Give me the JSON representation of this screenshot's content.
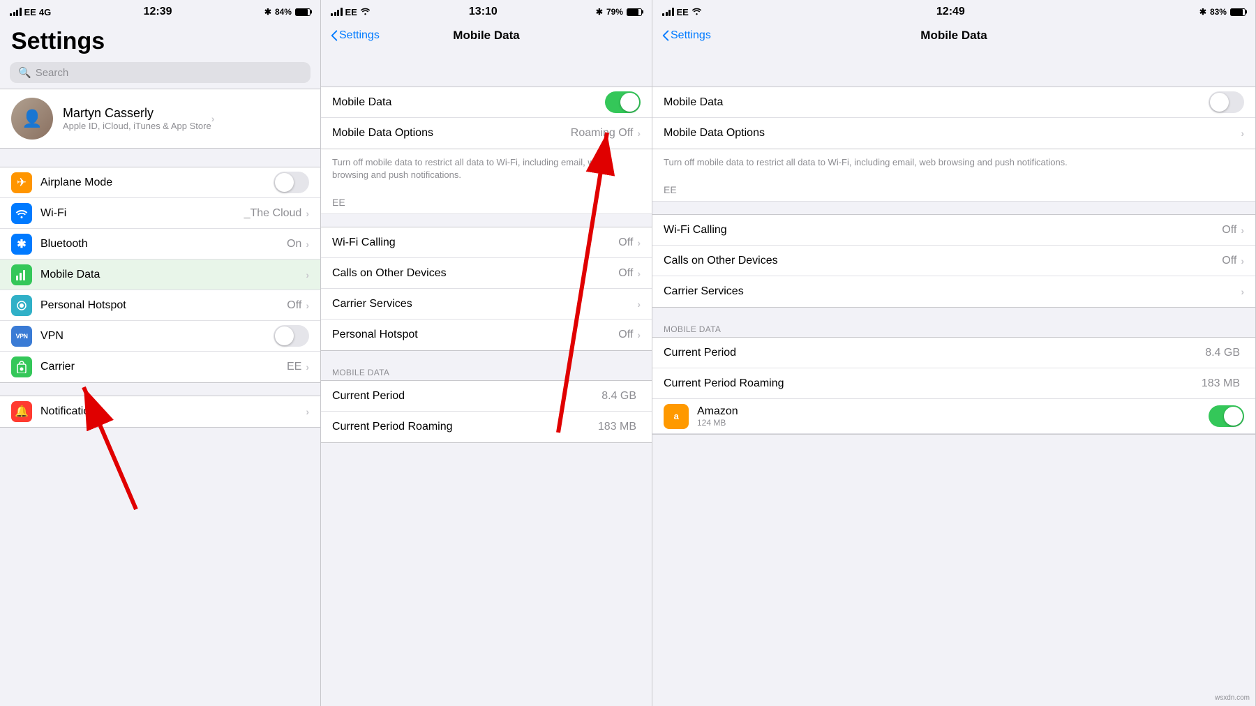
{
  "panel1": {
    "statusBar": {
      "carrier": "EE",
      "networkType": "4G",
      "time": "12:39",
      "btIcon": "✱",
      "batteryPct": "84%"
    },
    "largeTitle": "Settings",
    "user": {
      "name": "Martyn Casserly",
      "subtitle": "Apple ID, iCloud, iTunes & App Store"
    },
    "items": [
      {
        "label": "Airplane Mode",
        "value": "",
        "toggle": true,
        "toggleOn": false,
        "iconColor": "icon-orange",
        "iconChar": "✈"
      },
      {
        "label": "Wi-Fi",
        "value": "_The Cloud",
        "toggle": false,
        "iconColor": "icon-blue",
        "iconChar": "📶"
      },
      {
        "label": "Bluetooth",
        "value": "On",
        "toggle": false,
        "iconColor": "icon-bt",
        "iconChar": "✱"
      },
      {
        "label": "Mobile Data",
        "value": "",
        "toggle": false,
        "chevron": true,
        "iconColor": "icon-green",
        "iconChar": "📡"
      },
      {
        "label": "Personal Hotspot",
        "value": "Off",
        "toggle": false,
        "iconColor": "icon-teal",
        "iconChar": "🔗"
      },
      {
        "label": "VPN",
        "value": "",
        "toggle": true,
        "toggleOn": false,
        "iconColor": "icon-vpn",
        "iconChar": "VPN"
      },
      {
        "label": "Carrier",
        "value": "EE",
        "toggle": false,
        "iconColor": "icon-carrier",
        "iconChar": "📞"
      }
    ],
    "nextItem": {
      "label": "Notifications",
      "iconColor": "icon-notification",
      "iconChar": "🔔"
    }
  },
  "panel2": {
    "statusBar": {
      "carrier": "EE",
      "wifi": true,
      "time": "13:10",
      "btIcon": "✱",
      "batteryPct": "79%"
    },
    "navBack": "Settings",
    "navTitle": "Mobile Data",
    "items": [
      {
        "label": "Mobile Data",
        "value": "",
        "toggle": true,
        "toggleOn": true
      },
      {
        "label": "Mobile Data Options",
        "value": "Roaming Off",
        "chevron": true
      },
      {
        "label": "Wi-Fi Calling",
        "value": "Off",
        "chevron": true
      },
      {
        "label": "Calls on Other Devices",
        "value": "Off",
        "chevron": true
      },
      {
        "label": "Carrier Services",
        "value": "",
        "chevron": true
      },
      {
        "label": "Personal Hotspot",
        "value": "Off",
        "chevron": true
      }
    ],
    "description": "Turn off mobile data to restrict all data to Wi-Fi, including email, web browsing and push notifications.",
    "carrierLabel": "EE",
    "sectionHeader": "MOBILE DATA",
    "dataItems": [
      {
        "label": "Current Period",
        "value": "8.4 GB"
      },
      {
        "label": "Current Period Roaming",
        "value": "183 MB"
      }
    ]
  },
  "panel3": {
    "statusBar": {
      "carrier": "EE",
      "wifi": true,
      "time": "12:49",
      "btIcon": "✱",
      "batteryPct": "83%"
    },
    "navBack": "Settings",
    "navTitle": "Mobile Data",
    "items": [
      {
        "label": "Mobile Data",
        "value": "",
        "toggle": true,
        "toggleOn": false
      },
      {
        "label": "Mobile Data Options",
        "value": "",
        "chevron": true
      },
      {
        "label": "Wi-Fi Calling",
        "value": "Off",
        "chevron": true
      },
      {
        "label": "Calls on Other Devices",
        "value": "Off",
        "chevron": true
      },
      {
        "label": "Carrier Services",
        "value": "",
        "chevron": true
      }
    ],
    "description": "Turn off mobile data to restrict all data to Wi-Fi, including email, web browsing and push notifications.",
    "carrierLabel": "EE",
    "sectionHeader": "MOBILE DATA",
    "dataItems": [
      {
        "label": "Current Period",
        "value": "8.4 GB"
      },
      {
        "label": "Current Period Roaming",
        "value": "183 MB"
      }
    ],
    "appItem": {
      "name": "Amazon",
      "size": "124 MB",
      "toggleOn": true
    },
    "watermark": "wsxdn.com"
  }
}
